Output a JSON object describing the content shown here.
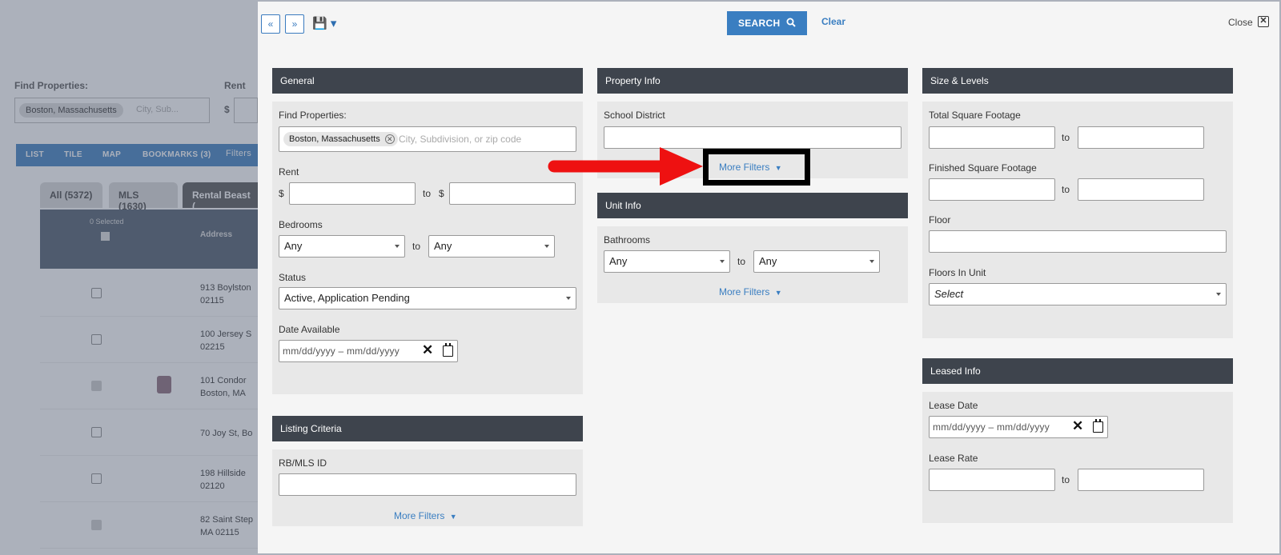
{
  "background_page": {
    "find_properties_label": "Find Properties:",
    "rent_label": "Rent",
    "dollar": "$",
    "chip": "Boston, Massachusetts",
    "search_placeholder": "City, Sub...",
    "tabs": [
      "LIST",
      "TILE",
      "MAP",
      "BOOKMARKS (3)"
    ],
    "filters_label": "Filters",
    "pills": [
      "All (5372)",
      "MLS (1630)",
      "Rental Beast ("
    ],
    "selected_count": "0 Selected",
    "address_header": "Address",
    "rows": [
      {
        "line1": "913 Boylston",
        "line2": "02115"
      },
      {
        "line1": "100 Jersey S",
        "line2": "02215"
      },
      {
        "line1": "101 Condor",
        "line2": "Boston, MA"
      },
      {
        "line1": "70 Joy St, Bo",
        "line2": ""
      },
      {
        "line1": "198 Hillside",
        "line2": "02120"
      },
      {
        "line1": "82 Saint Step",
        "line2": "MA 02115"
      }
    ]
  },
  "toolbar": {
    "expand_all": "«",
    "collapse_all": "»",
    "save": "💾 ▾",
    "search_label": "SEARCH",
    "clear_label": "Clear",
    "close_label": "Close",
    "close_x": "✕"
  },
  "general": {
    "title": "General",
    "find_properties_label": "Find Properties:",
    "chip": "Boston, Massachusetts",
    "search_placeholder": "City, Subdivision, or zip code",
    "rent_label": "Rent",
    "currency": "$",
    "to": "to",
    "bedrooms_label": "Bedrooms",
    "bedrooms_min": "Any",
    "bedrooms_max": "Any",
    "status_label": "Status",
    "status_value": "Active, Application Pending",
    "date_available_label": "Date Available",
    "date_placeholder": "mm/dd/yyyy – mm/dd/yyyy"
  },
  "listing_criteria": {
    "title": "Listing Criteria",
    "id_label": "RB/MLS ID",
    "more_filters": "More Filters"
  },
  "property_info": {
    "title": "Property Info",
    "school_district_label": "School District",
    "more_filters": "More Filters"
  },
  "unit_info": {
    "title": "Unit Info",
    "bathrooms_label": "Bathrooms",
    "bathrooms_min": "Any",
    "bathrooms_max": "Any",
    "to": "to",
    "more_filters": "More Filters"
  },
  "size_levels": {
    "title": "Size & Levels",
    "total_sqft_label": "Total Square Footage",
    "finished_sqft_label": "Finished Square Footage",
    "floor_label": "Floor",
    "floors_in_unit_label": "Floors In Unit",
    "floors_in_unit_value": "Select",
    "to": "to"
  },
  "leased_info": {
    "title": "Leased Info",
    "lease_date_label": "Lease Date",
    "date_placeholder": "mm/dd/yyyy – mm/dd/yyyy",
    "lease_rate_label": "Lease Rate",
    "to": "to"
  },
  "colors": {
    "accent": "#3a7ec1",
    "section_header": "#3e444d",
    "section_body": "#e8e8e8",
    "annotation_arrow": "#ee1111"
  },
  "icons": {
    "chevron": "chevron-down-icon",
    "search": "search-icon",
    "save": "save-icon",
    "calendar": "calendar-icon",
    "clear": "x-icon"
  }
}
